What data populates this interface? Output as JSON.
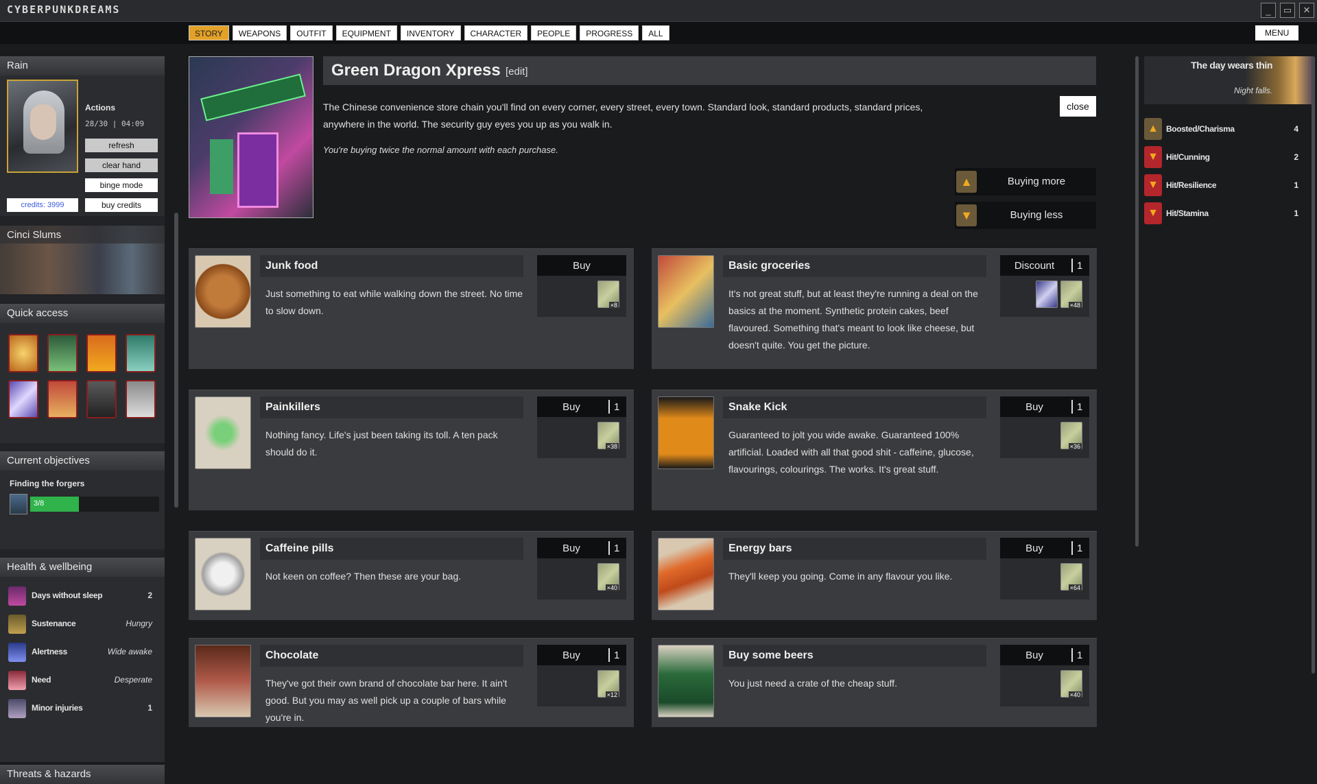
{
  "app": {
    "logo": "CYBERPUNKDREAMS",
    "window_buttons": [
      "minimize-icon",
      "restore-icon",
      "close-icon"
    ]
  },
  "nav": {
    "tabs": [
      "STORY",
      "WEAPONS",
      "OUTFIT",
      "EQUIPMENT",
      "INVENTORY",
      "CHARACTER",
      "PEOPLE",
      "PROGRESS",
      "ALL"
    ],
    "active_tab": "STORY",
    "menu_label": "MENU"
  },
  "profile": {
    "name": "Rain",
    "actions_title": "Actions",
    "counter": "28/30 | 04:09",
    "buttons": [
      "refresh",
      "clear hand",
      "binge mode",
      "buy credits"
    ],
    "credits": "credits: 3999"
  },
  "location": {
    "name": "Cinci Slums"
  },
  "quick_access": {
    "title": "Quick access",
    "items": [
      "bokeh-lights-icon",
      "energy-drink-icon",
      "snake-kick-icon",
      "circuit-icon",
      "lightning-icon",
      "groceries-icon",
      "device-icon",
      "pills-icon"
    ]
  },
  "objectives": {
    "title": "Current objectives",
    "items": [
      {
        "name": "Finding the forgers",
        "progress_text": "3/8",
        "progress": 0.375
      }
    ]
  },
  "health": {
    "title": "Health & wellbeing",
    "rows": [
      {
        "label": "Days without sleep",
        "value": "2"
      },
      {
        "label": "Sustenance",
        "value": "Hungry"
      },
      {
        "label": "Alertness",
        "value": "Wide awake"
      },
      {
        "label": "Need",
        "value": "Desperate"
      },
      {
        "label": "Minor injuries",
        "value": "1"
      }
    ]
  },
  "threats": {
    "title": "Threats & hazards"
  },
  "story": {
    "title": "Green Dragon Xpress",
    "edit_label": "[edit]",
    "description": "The Chinese convenience store chain you'll find on every corner, every street, every town. Standard look, standard products, standard prices, anywhere in the world. The security guy eyes you up as you walk in.",
    "note": "You're buying twice the normal amount with each purchase.",
    "close_label": "close",
    "buy_more_label": "Buying more",
    "buy_less_label": "Buying less"
  },
  "items": [
    {
      "title": "Junk food",
      "desc": "Just something to eat while walking down the street. No time to slow down.",
      "action": "Buy",
      "qty": "",
      "prices": [
        "×8"
      ]
    },
    {
      "title": "Basic groceries",
      "desc": "It's not great stuff, but at least they're running a deal on the basics at the moment. Synthetic protein cakes, beef flavoured. Something that's meant to look like cheese, but doesn't quite. You get the picture.",
      "action": "Discount",
      "qty": "1",
      "prices": [
        "",
        "×48"
      ]
    },
    {
      "title": "Painkillers",
      "desc": "Nothing fancy. Life's just been taking its toll. A ten pack should do it.",
      "action": "Buy",
      "qty": "1",
      "prices": [
        "×38"
      ]
    },
    {
      "title": "Snake Kick",
      "desc": "Guaranteed to jolt you wide awake. Guaranteed 100% artificial. Loaded with all that good shit - caffeine, glucose, flavourings, colourings. The works. It's great stuff.",
      "action": "Buy",
      "qty": "1",
      "prices": [
        "×36"
      ]
    },
    {
      "title": "Caffeine pills",
      "desc": "Not keen on coffee? Then these are your bag.",
      "action": "Buy",
      "qty": "1",
      "prices": [
        "×40"
      ]
    },
    {
      "title": "Energy bars",
      "desc": "They'll keep you going. Come in any flavour you like.",
      "action": "Buy",
      "qty": "1",
      "prices": [
        "×64"
      ]
    },
    {
      "title": "Chocolate",
      "desc": "They've got their own brand of chocolate bar here. It ain't good. But you may as well pick up a couple of bars while you're in.",
      "action": "Buy",
      "qty": "1",
      "prices": [
        "×12"
      ]
    },
    {
      "title": "Buy some beers",
      "desc": "You just need a crate of the cheap stuff.",
      "action": "Buy",
      "qty": "1",
      "prices": [
        "×40"
      ]
    }
  ],
  "day": {
    "title": "The day wears thin",
    "subtitle": "Night falls."
  },
  "effects": [
    {
      "label": "Boosted/Charisma",
      "value": "4",
      "dir": "up"
    },
    {
      "label": "Hit/Cunning",
      "value": "2",
      "dir": "down"
    },
    {
      "label": "Hit/Resilience",
      "value": "1",
      "dir": "down"
    },
    {
      "label": "Hit/Stamina",
      "value": "1",
      "dir": "down"
    }
  ],
  "colors": {
    "accent": "#e3a127",
    "progress": "#2fb34a",
    "hit": "#b3262b"
  }
}
